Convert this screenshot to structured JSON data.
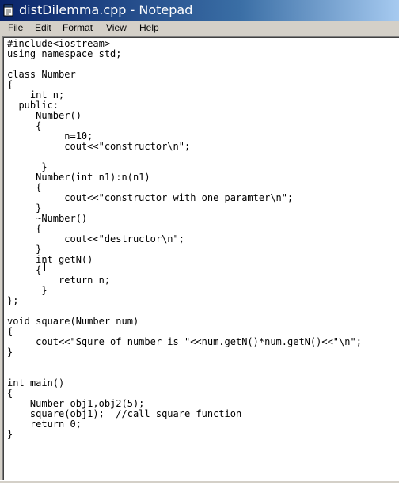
{
  "window": {
    "title": "distDilemma.cpp - Notepad",
    "icon": "notepad-icon",
    "colors": {
      "titlebar_start": "#0a246a",
      "titlebar_end": "#a6caf0",
      "chrome": "#d4d0c8"
    }
  },
  "menu": {
    "items": [
      {
        "label_ul": "F",
        "label_rest": "ile"
      },
      {
        "label_ul": "E",
        "label_rest": "dit"
      },
      {
        "label_pre": "F",
        "label_ul": "o",
        "label_rest": "rmat"
      },
      {
        "label_ul": "V",
        "label_rest": "iew"
      },
      {
        "label_ul": "H",
        "label_rest": "elp"
      }
    ]
  },
  "editor": {
    "content": "#include<iostream>\nusing namespace std;\n\nclass Number\n{\n    int n;\n  public:\n     Number()\n     {\n          n=10;\n          cout<<\"constructor\\n\";\n\n      }\n     Number(int n1):n(n1)\n     {\n          cout<<\"constructor with one paramter\\n\";\n     }\n     ~Number()\n     {\n          cout<<\"destructor\\n\";\n     }\n     int getN()\n     {\n         return n;\n      }\n};\n\nvoid square(Number num)\n{\n     cout<<\"Squre of number is \"<<num.getN()*num.getN()<<\"\\n\";\n}\n\n\nint main()\n{\n    Number obj1,obj2(5);\n    square(obj1);  //call square function\n    return 0;\n}"
  }
}
